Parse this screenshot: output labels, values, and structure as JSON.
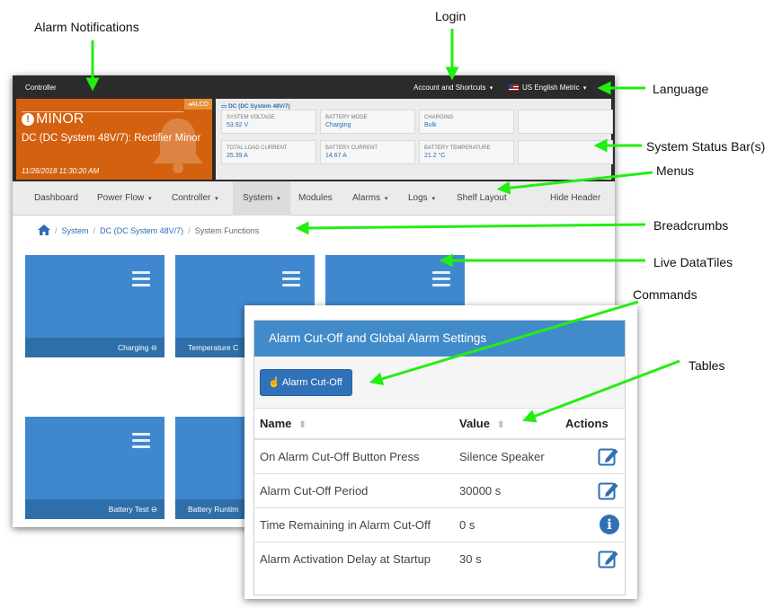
{
  "callouts": {
    "alarm_notifications": "Alarm Notifications",
    "login": "Login",
    "language": "Language",
    "system_status_bars": "System Status Bar(s)",
    "menus": "Menus",
    "breadcrumbs": "Breadcrumbs",
    "live_datatiles": "Live DataTiles",
    "commands": "Commands",
    "tables": "Tables"
  },
  "topbar": {
    "brand": "Controller",
    "account": "Account and Shortcuts",
    "language": "US English Metric"
  },
  "alarm": {
    "badge": "◂ALCO",
    "severity": "MINOR",
    "description": "DC (DC System 48V/7): Rectifier Minor",
    "time": "11/26/2018 11:30:20 AM"
  },
  "system_status": {
    "title": "DC (DC System 48V/7)",
    "tiles": [
      {
        "label": "SYSTEM VOLTAGE",
        "value": "53.92 V"
      },
      {
        "label": "BATTERY MODE",
        "value": "Charging"
      },
      {
        "label": "CHARGING",
        "value": "Bulk"
      },
      {
        "label": "TOTAL LOAD CURRENT",
        "value": "25.39 A"
      },
      {
        "label": "BATTERY CURRENT",
        "value": "14.67 A"
      },
      {
        "label": "BATTERY TEMPERATURE",
        "value": "21.2 °C"
      }
    ]
  },
  "nav": {
    "items": [
      {
        "label": "Dashboard",
        "caret": ""
      },
      {
        "label": "Power Flow",
        "caret": "▾"
      },
      {
        "label": "Controller",
        "caret": "▾"
      },
      {
        "label": "System",
        "caret": "▾"
      },
      {
        "label": "Modules",
        "caret": ""
      },
      {
        "label": "Alarms",
        "caret": "▾"
      },
      {
        "label": "Logs",
        "caret": "▾"
      },
      {
        "label": "Shelf Layout",
        "caret": ""
      }
    ],
    "hide_header": "Hide Header"
  },
  "breadcrumb": {
    "sep": "/",
    "items": [
      "System",
      "DC (DC System 48V/7)",
      "System Functions"
    ]
  },
  "datatiles": [
    {
      "label": "Charging ⊖"
    },
    {
      "label": "Temperature C"
    },
    {
      "label": ""
    },
    {
      "label": "Battery Test ⊖"
    },
    {
      "label": "Battery Runtim"
    }
  ],
  "modal": {
    "title": "Alarm Cut-Off and Global Alarm Settings",
    "button": "Alarm Cut-Off",
    "button_icon": "hand-pointer-icon",
    "columns": {
      "name": "Name",
      "value": "Value",
      "actions": "Actions"
    },
    "sort_glyph": "⬍",
    "rows": [
      {
        "name": "On Alarm Cut-Off Button Press",
        "value": "Silence Speaker",
        "action": "edit"
      },
      {
        "name": "Alarm Cut-Off Period",
        "value": "30000 s",
        "action": "edit"
      },
      {
        "name": "Time Remaining in Alarm Cut-Off",
        "value": "0 s",
        "action": "info"
      },
      {
        "name": "Alarm Activation Delay at Startup",
        "value": "30 s",
        "action": "edit"
      }
    ]
  },
  "colors": {
    "arrow": "#22ee11",
    "alarm_bg": "#d4610f",
    "tile_blue": "#3f88cf",
    "header_blue": "#428bca"
  }
}
